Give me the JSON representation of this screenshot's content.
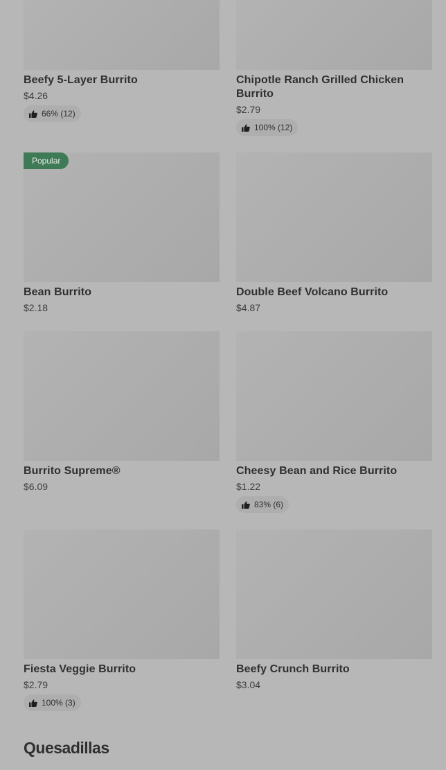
{
  "items": [
    {
      "name": "Beefy 5-Layer Burrito",
      "price": "$4.26",
      "rating": "66% (12)"
    },
    {
      "name": "Chipotle Ranch Grilled Chicken Burrito",
      "price": "$2.79",
      "rating": "100% (12)"
    },
    {
      "name": "Bean Burrito",
      "price": "$2.18",
      "badge": "Popular"
    },
    {
      "name": "Double Beef Volcano Burrito",
      "price": "$4.87"
    },
    {
      "name": "Burrito Supreme®",
      "price": "$6.09"
    },
    {
      "name": "Cheesy Bean and Rice Burrito",
      "price": "$1.22",
      "rating": "83% (6)"
    },
    {
      "name": "Fiesta Veggie Burrito",
      "price": "$2.79",
      "rating": "100% (3)"
    },
    {
      "name": "Beefy Crunch Burrito",
      "price": "$3.04"
    }
  ],
  "next_section": {
    "title": "Quesadillas"
  },
  "icons": {
    "rating": "thumbs-up-icon"
  },
  "colors": {
    "badge": "#3e7a55",
    "background": "#b7b7b7"
  }
}
